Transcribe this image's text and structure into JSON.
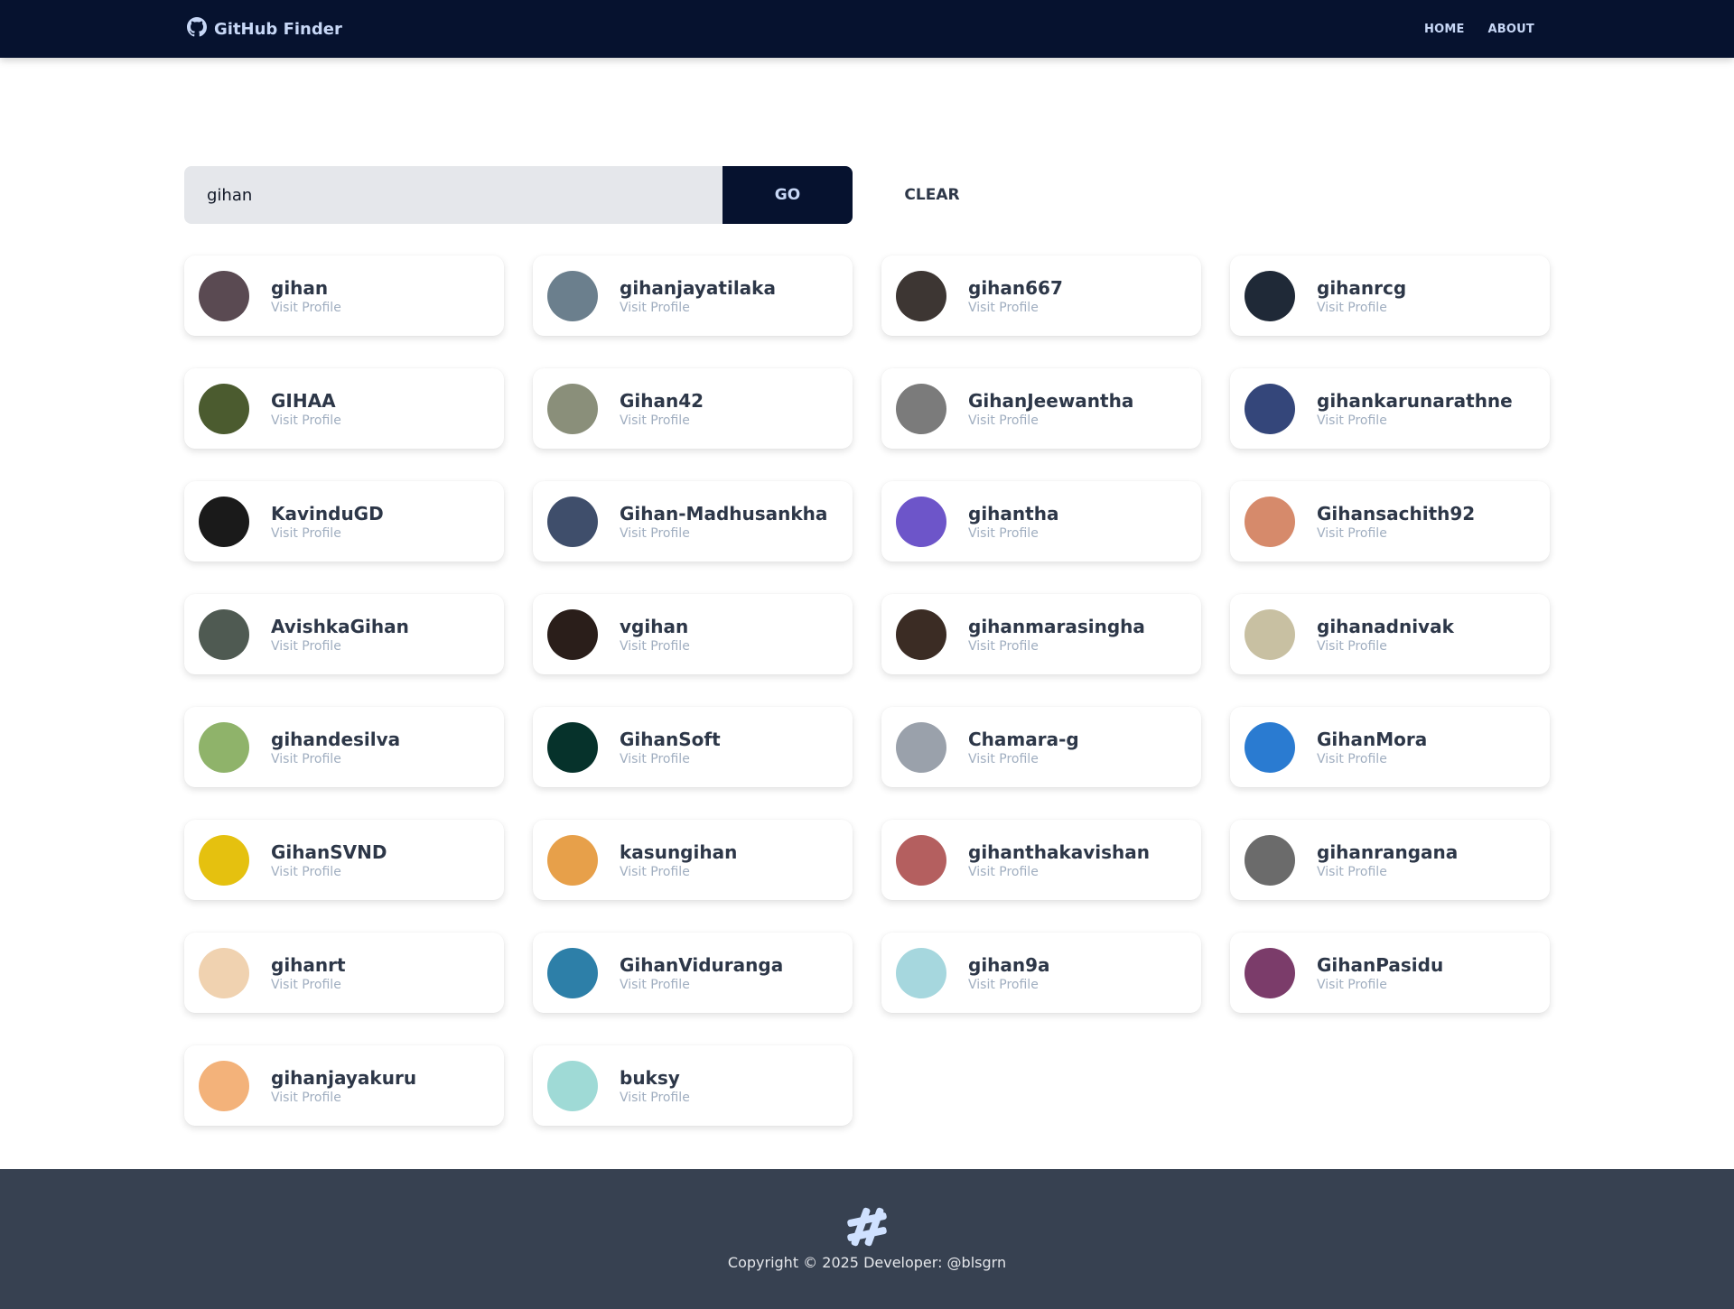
{
  "navbar": {
    "brand": "GitHub Finder",
    "brand_icon": "github-icon",
    "links": [
      "HOME",
      "ABOUT"
    ]
  },
  "search": {
    "value": "gihan",
    "go_label": "GO",
    "clear_label": "CLEAR"
  },
  "results": {
    "visit_label": "Visit Profile",
    "users": [
      {
        "login": "gihan",
        "color": "#5a4a52"
      },
      {
        "login": "gihanjayatilaka",
        "color": "#6b7f8d"
      },
      {
        "login": "gihan667",
        "color": "#3d3633"
      },
      {
        "login": "gihanrcg",
        "color": "#1f2937"
      },
      {
        "login": "GIHAA",
        "color": "#4b5b2f"
      },
      {
        "login": "Gihan42",
        "color": "#8a8f7a"
      },
      {
        "login": "GihanJeewantha",
        "color": "#7b7b7b"
      },
      {
        "login": "gihankarunarathne",
        "color": "#34467a"
      },
      {
        "login": "KavinduGD",
        "color": "#1a1a1a"
      },
      {
        "login": "Gihan-Madhusankha",
        "color": "#3f4e6b"
      },
      {
        "login": "gihantha",
        "color": "#6d55c9"
      },
      {
        "login": "Gihansachith92",
        "color": "#d68a6b"
      },
      {
        "login": "AvishkaGihan",
        "color": "#4f5a52"
      },
      {
        "login": "vgihan",
        "color": "#2a1e1a"
      },
      {
        "login": "gihanmarasingha",
        "color": "#3b2c24"
      },
      {
        "login": "gihanadnivak",
        "color": "#c8c0a2"
      },
      {
        "login": "gihandesilva",
        "color": "#8fb36a"
      },
      {
        "login": "GihanSoft",
        "color": "#06322b"
      },
      {
        "login": "Chamara-g",
        "color": "#9aa1ab"
      },
      {
        "login": "GihanMora",
        "color": "#2a7bd1"
      },
      {
        "login": "GihanSVND",
        "color": "#e5c10f"
      },
      {
        "login": "kasungihan",
        "color": "#e7a04a"
      },
      {
        "login": "gihanthakavishan",
        "color": "#b45f5f"
      },
      {
        "login": "gihanrangana",
        "color": "#6b6b6b"
      },
      {
        "login": "gihanrt",
        "color": "#f0d2b0"
      },
      {
        "login": "GihanViduranga",
        "color": "#2d7fa8"
      },
      {
        "login": "gihan9a",
        "color": "#a6d7de"
      },
      {
        "login": "GihanPasidu",
        "color": "#7b3c6a"
      },
      {
        "login": "gihanjayakuru",
        "color": "#f3b27a"
      },
      {
        "login": "buksy",
        "color": "#9fdad6"
      }
    ]
  },
  "footer": {
    "icon": "hashtag-icon",
    "text": "Copyright © 2025 Developer: @blsgrn"
  }
}
